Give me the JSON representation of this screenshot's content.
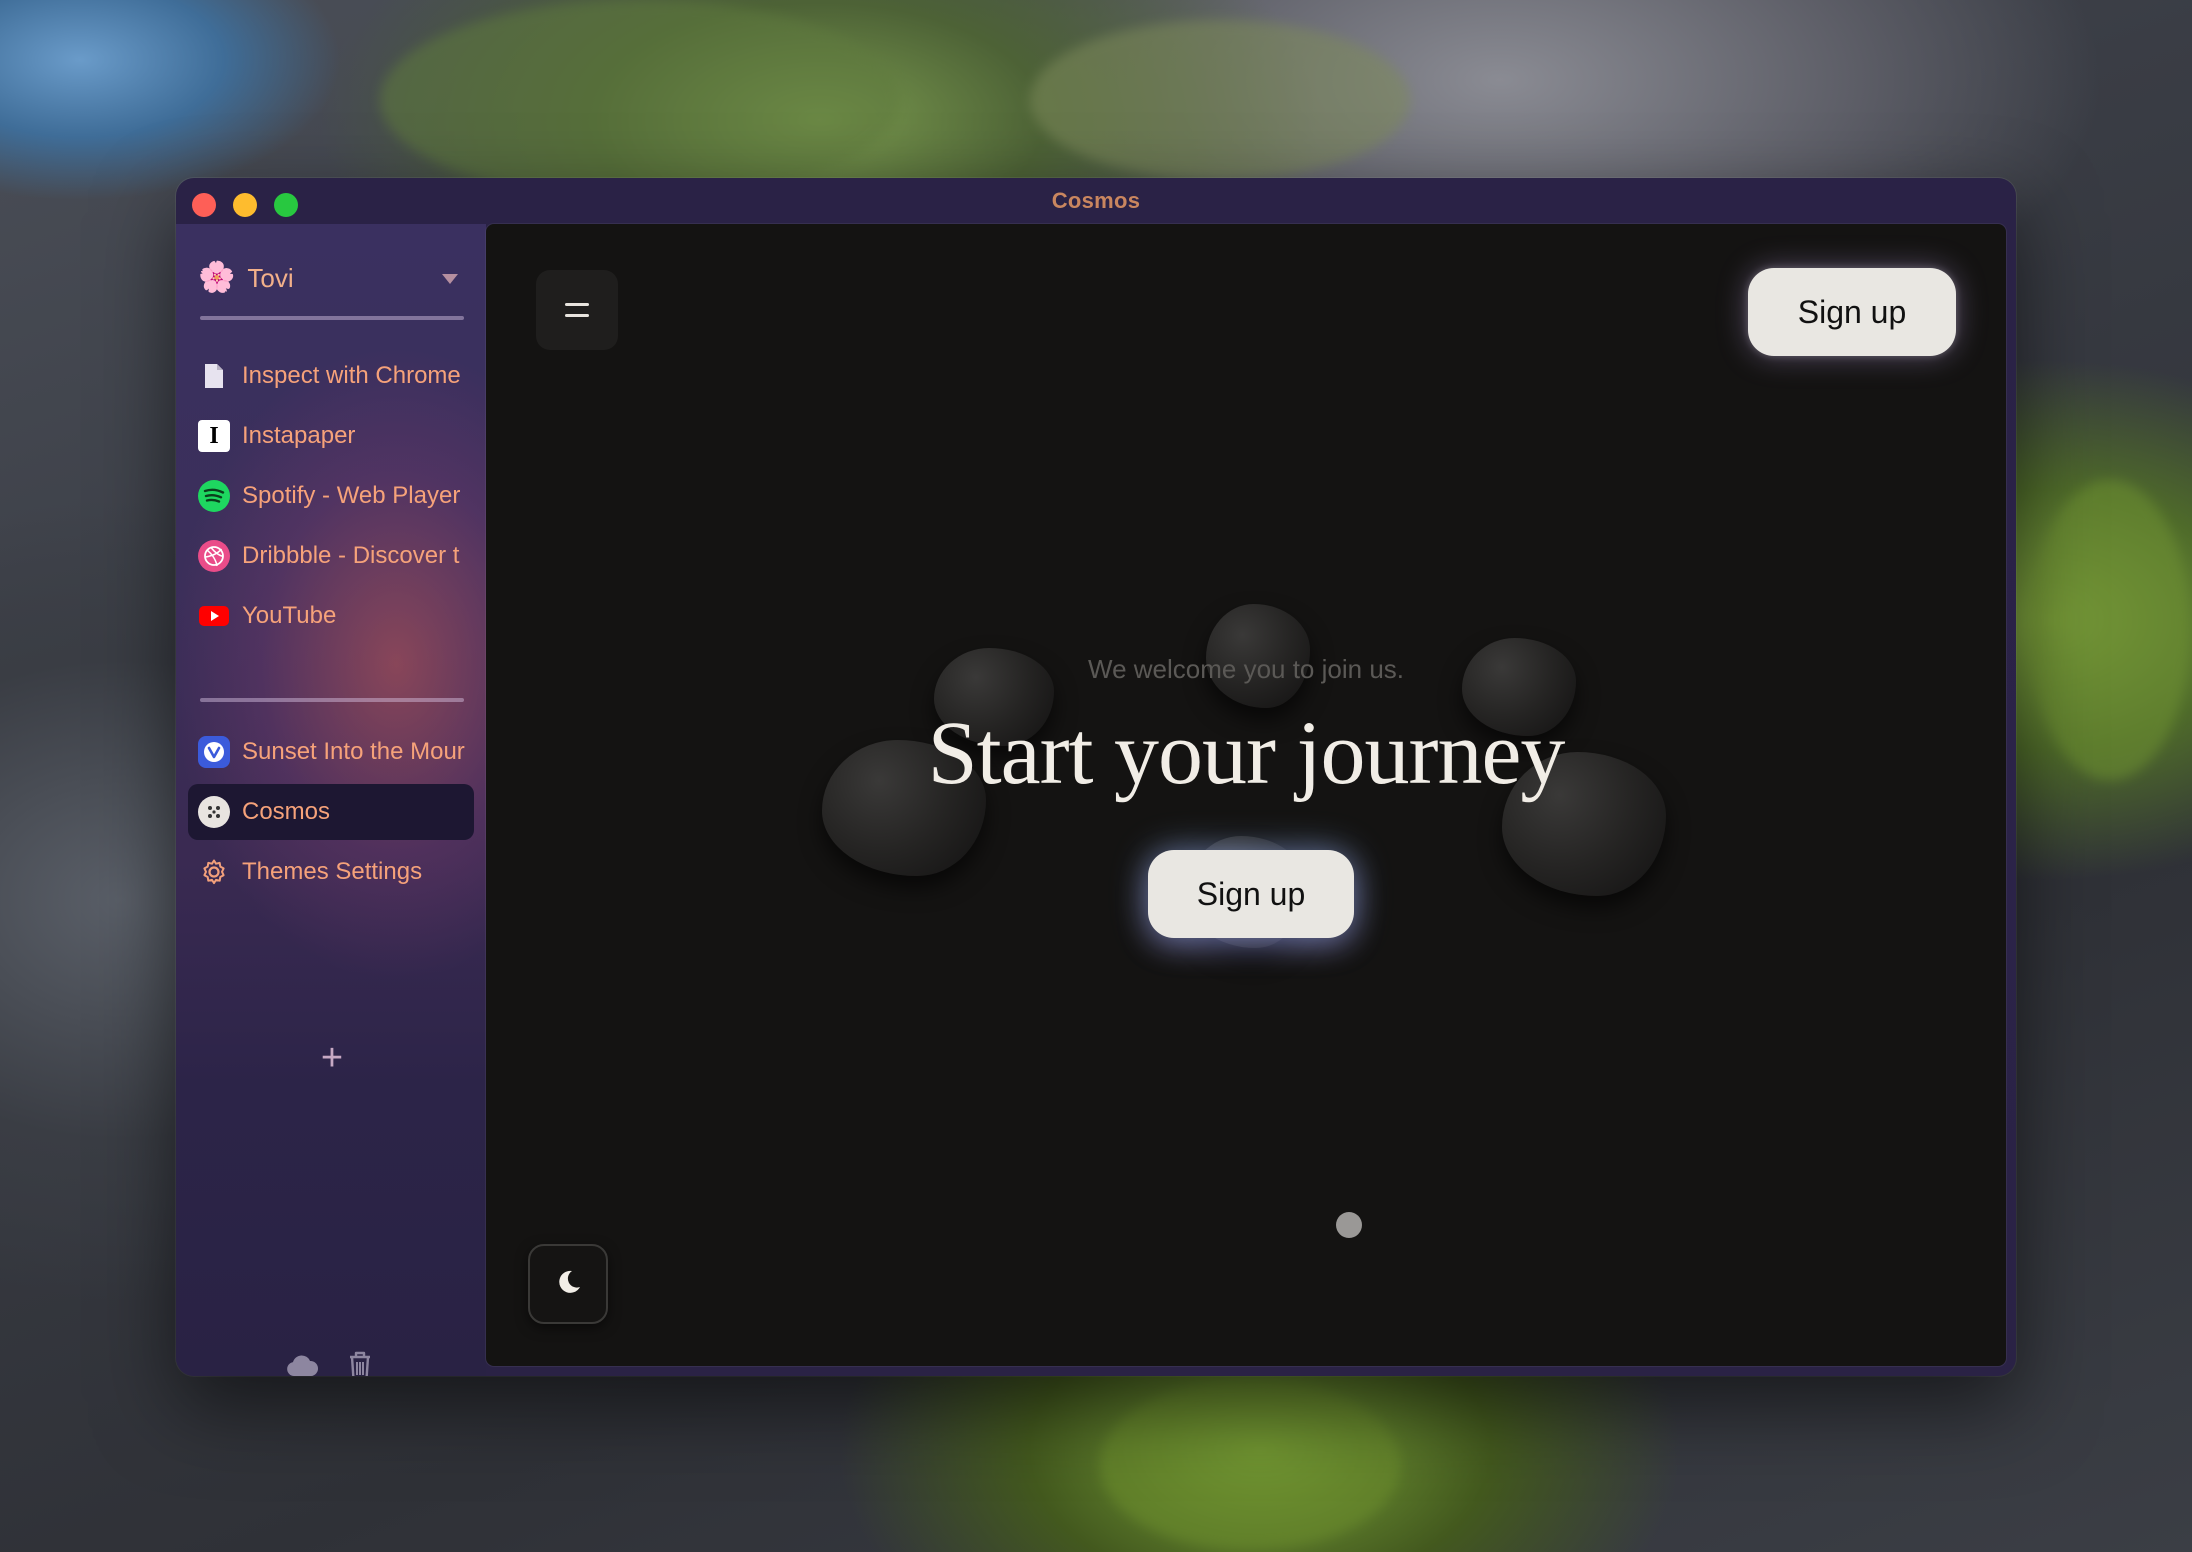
{
  "window": {
    "title": "Cosmos"
  },
  "sidebar": {
    "profile": {
      "name": "Tovi",
      "icon": "flower-emoji"
    },
    "pinned": [
      {
        "label": "Inspect with Chrome",
        "icon": "document-icon"
      },
      {
        "label": "Instapaper",
        "icon": "instapaper-icon"
      },
      {
        "label": "Spotify - Web Player",
        "icon": "spotify-icon"
      },
      {
        "label": "Dribbble - Discover t",
        "icon": "dribbble-icon"
      },
      {
        "label": "YouTube",
        "icon": "youtube-icon"
      }
    ],
    "tabs": [
      {
        "label": "Sunset Into the Mour",
        "icon": "vivaldi-icon"
      },
      {
        "label": "Cosmos",
        "icon": "cosmos-icon",
        "active": true
      },
      {
        "label": "Themes Settings",
        "icon": "gear-icon"
      }
    ],
    "add_label": "+",
    "bottom_icons": [
      "cloud-icon",
      "trash-icon"
    ]
  },
  "page": {
    "tagline": "We welcome you to join us.",
    "headline": "Start your journey",
    "signup_top_label": "Sign up",
    "signup_main_label": "Sign up"
  },
  "colors": {
    "accent_text": "#f6a27a",
    "sidebar_active_bg": "#1d1732",
    "content_bg": "#141312",
    "button_bg": "#e9e7e2"
  }
}
